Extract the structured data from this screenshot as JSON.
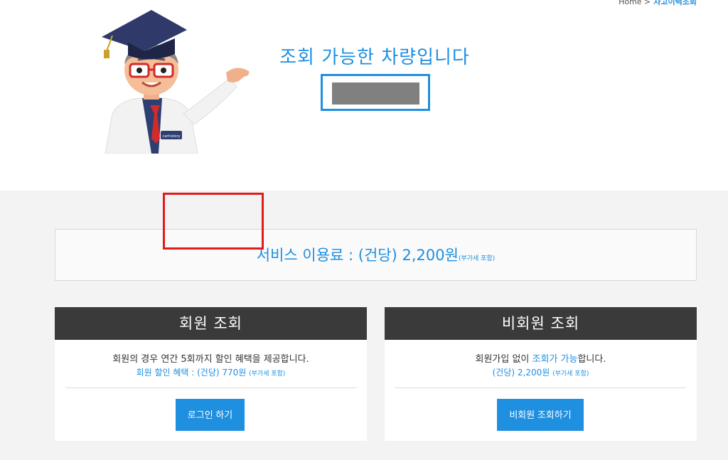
{
  "breadcrumb": {
    "home": "Home >",
    "current": "차고이력조회"
  },
  "result": {
    "title": "조회 가능한 차량입니다",
    "plate_masked": ""
  },
  "fee": {
    "label": "서비스 이용료 : (건당) 2,200원",
    "note": "(부가세 포함)"
  },
  "member_card": {
    "title": "회원 조회",
    "line1": "회원의 경우 연간 5회까지 할인 혜택을 제공합니다.",
    "line2_main": "회원 할인 혜택 : (건당) 770원",
    "line2_note": "(부가세 포함)",
    "button": "로그인 하기"
  },
  "guest_card": {
    "title": "비회원 조회",
    "line1_a": "회원가입 없이 ",
    "line1_hl": "조회가 가능",
    "line1_b": "합니다.",
    "line2_main": "(건당) 2,200원",
    "line2_note": "(부가세 포함)",
    "button": "비회원 조회하기"
  },
  "mascot": {
    "icon": "doctor-mascot-icon",
    "badge": "carhistory"
  },
  "colors": {
    "accent": "#1f8fe0",
    "header": "#3a3a3a",
    "highlight": "#e01b1b"
  }
}
